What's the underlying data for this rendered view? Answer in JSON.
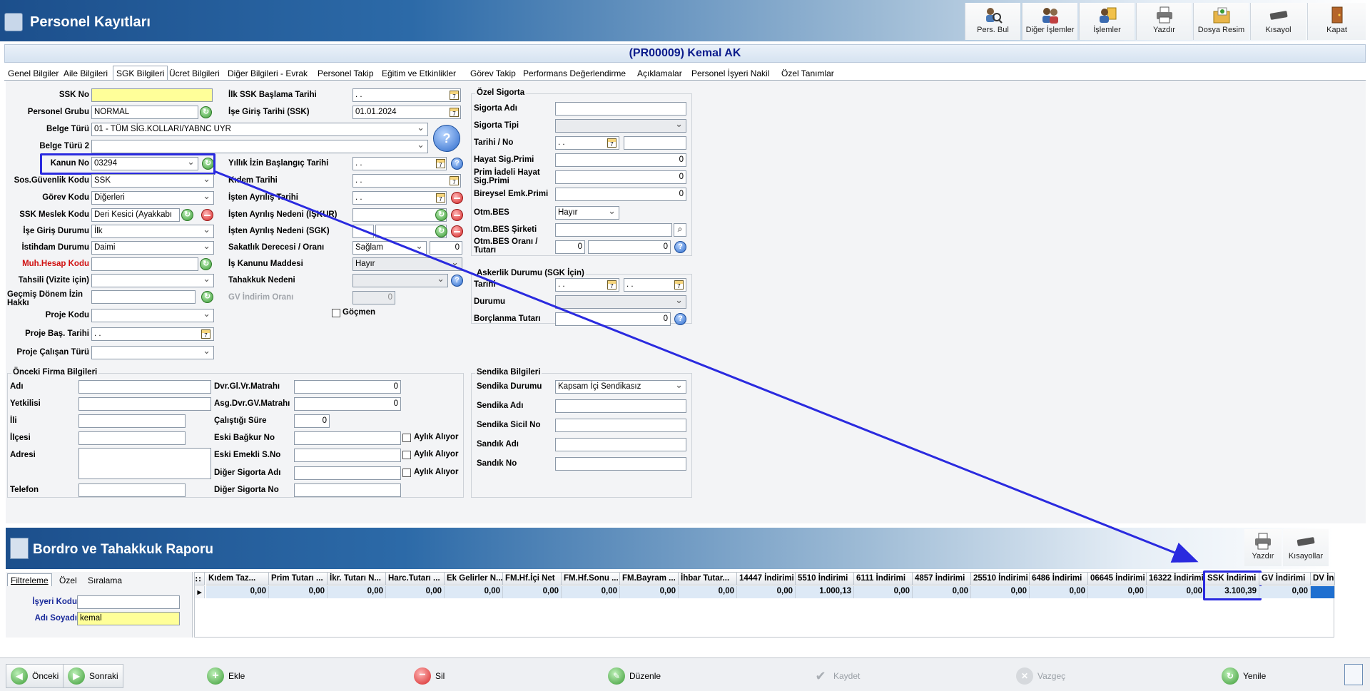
{
  "window": {
    "title": "Personel Kayıtları"
  },
  "toolbar": [
    {
      "label": "Pers. Bul",
      "icon": "search-person-icon"
    },
    {
      "label": "Diğer İşlemler",
      "icon": "people-icon"
    },
    {
      "label": "İşlemler",
      "icon": "person-list-icon"
    },
    {
      "label": "Yazdır",
      "icon": "printer-icon"
    },
    {
      "label": "Dosya Resim",
      "icon": "folder-image-icon"
    },
    {
      "label": "Kısayol",
      "icon": "keyboard-icon"
    },
    {
      "label": "Kapat",
      "icon": "exit-door-icon"
    }
  ],
  "record": {
    "heading": "(PR00009) Kemal AK"
  },
  "tabs": [
    "Genel Bilgiler",
    "Aile Bilgileri",
    "SGK Bilgileri",
    "Ücret Bilgileri",
    "Diğer Bilgileri - Evrak",
    "Personel Takip",
    "Eğitim ve Etkinlikler",
    "Görev Takip",
    "Performans Değerlendirme",
    "Açıklamalar",
    "Personel İşyeri Nakil",
    "Özel Tanımlar"
  ],
  "left_form": {
    "ssk_no": {
      "label": "SSK No",
      "value": ""
    },
    "personel_grubu": {
      "label": "Personel Grubu",
      "value": "NORMAL"
    },
    "belge_turu": {
      "label": "Belge Türü",
      "value": "01 - TÜM SİG.KOLLARI/YABNC UYR"
    },
    "belge_turu_2": {
      "label": "Belge Türü 2",
      "value": ""
    },
    "kanun_no": {
      "label": "Kanun No",
      "value": "03294"
    },
    "sos_guvenlik": {
      "label": "Sos.Güvenlik Kodu",
      "value": "SSK"
    },
    "gorev_kodu": {
      "label": "Görev Kodu",
      "value": "Diğerleri"
    },
    "ssk_meslek": {
      "label": "SSK Meslek Kodu",
      "value": "Deri Kesici (Ayakkabı"
    },
    "ise_giris_durumu": {
      "label": "İşe Giriş Durumu",
      "value": "İlk"
    },
    "istihdam": {
      "label": "İstihdam Durumu",
      "value": "Daimi"
    },
    "muh_hesap": {
      "label": "Muh.Hesap Kodu",
      "value": ""
    },
    "tahsili": {
      "label": "Tahsili (Vizite için)",
      "value": ""
    },
    "gecmis_donem": {
      "label": "Geçmiş Dönem İzin Hakkı",
      "value": ""
    },
    "proje_kodu": {
      "label": "Proje Kodu",
      "value": ""
    },
    "proje_bas": {
      "label": "Proje Baş. Tarihi",
      "value": ". ."
    },
    "proje_calisan": {
      "label": "Proje Çalışan Türü",
      "value": ""
    }
  },
  "mid_form": {
    "ilk_ssk": {
      "label": "İlk SSK Başlama Tarihi",
      "value": ". ."
    },
    "ise_giris": {
      "label": "İşe Giriş Tarihi (SSK)",
      "value": "01.01.2024"
    },
    "yillik_izin": {
      "label": "Yıllık İzin Başlangıç Tarihi",
      "value": ". ."
    },
    "kidem": {
      "label": "Kıdem Tarihi",
      "value": ". ."
    },
    "isten_ayrilis": {
      "label": "İşten Ayrılış Tarihi",
      "value": ". ."
    },
    "ayrilis_iskur": {
      "label": "İşten Ayrılış Nedeni (İŞKUR)",
      "value": ""
    },
    "ayrilis_sgk": {
      "label": "İşten Ayrılış Nedeni (SGK)",
      "value": ""
    },
    "sakatlik": {
      "label": "Sakatlık Derecesi / Oranı",
      "value": "Sağlam",
      "oran": "0"
    },
    "is_kanunu": {
      "label": "İş Kanunu Maddesi",
      "value": "Hayır"
    },
    "tahakkuk": {
      "label": "Tahakkuk Nedeni",
      "value": ""
    },
    "gv_indirim": {
      "label": "GV İndirim Oranı",
      "value": "0"
    },
    "gocmen": {
      "label": "Göçmen"
    }
  },
  "ozel_sigorta": {
    "title": "Özel Sigorta",
    "sigorta_adi": {
      "label": "Sigorta Adı",
      "value": ""
    },
    "sigorta_tipi": {
      "label": "Sigorta Tipi",
      "value": ""
    },
    "tarihi_no": {
      "label": "Tarihi / No",
      "value": ". .",
      "no": ""
    },
    "hayat": {
      "label": "Hayat Sig.Primi",
      "value": "0"
    },
    "prim_iadeli": {
      "label": "Prim İadeli Hayat Sig.Primi",
      "value": "0"
    },
    "bireysel": {
      "label": "Bireysel Emk.Primi",
      "value": "0"
    },
    "otm_bes": {
      "label": "Otm.BES",
      "value": "Hayır"
    },
    "otm_bes_sirketi": {
      "label": "Otm.BES Şirketi",
      "value": ""
    },
    "otm_bes_oran": {
      "label": "Otm.BES Oranı / Tutarı",
      "oran": "0",
      "tutar": "0"
    }
  },
  "askerlik": {
    "title": "Askerlik Durumu (SGK İçin)",
    "tarihi": {
      "label": "Tarihi",
      "v1": ". .",
      "v2": ". ."
    },
    "durumu": {
      "label": "Durumu",
      "value": ""
    },
    "borclanma": {
      "label": "Borçlanma Tutarı",
      "value": "0"
    }
  },
  "onceki_firma": {
    "title": "Önceki Firma Bilgileri",
    "adi": "Adı",
    "yetkilisi": "Yetkilisi",
    "ili": "İli",
    "ilcesi": "İlçesi",
    "adresi": "Adresi",
    "telefon": "Telefon",
    "dvr_gl": {
      "label": "Dvr.Gl.Vr.Matrahı",
      "value": "0"
    },
    "asg_dvr": {
      "label": "Asg.Dvr.GV.Matrahı",
      "value": "0"
    },
    "calistigi": {
      "label": "Çalıştığı Süre",
      "value": "0"
    },
    "eski_bagkur": "Eski Bağkur No",
    "eski_emekli": "Eski Emekli S.No",
    "diger_sigorta_adi": "Diğer Sigorta Adı",
    "diger_sigorta_no": "Diğer Sigorta No",
    "aylik_aliyor": "Aylık Alıyor"
  },
  "sendika": {
    "title": "Sendika Bilgileri",
    "durumu": {
      "label": "Sendika Durumu",
      "value": "Kapsam İçi Sendikasız"
    },
    "adi": "Sendika Adı",
    "sicil": "Sendika Sicil No",
    "sandik_adi": "Sandık Adı",
    "sandik_no": "Sandık No"
  },
  "report": {
    "title": "Bordro ve Tahakkuk Raporu",
    "toolbar": [
      {
        "label": "Yazdır",
        "icon": "printer-icon"
      },
      {
        "label": "Kısayollar",
        "icon": "keyboard-icon"
      }
    ],
    "filter_tabs": [
      "Filtreleme",
      "Özel",
      "Sıralama"
    ],
    "isyeri_kodu": {
      "label": "İşyeri Kodu",
      "value": ""
    },
    "adi_soyadi": {
      "label": "Adı Soyadı",
      "value": "kemal"
    },
    "columns": [
      "Kıdem Taz...",
      "Prim Tutarı ...",
      "İkr. Tutarı N...",
      "Harc.Tutarı ...",
      "Ek Gelirler N...",
      "FM.Hf.İçi Net",
      "FM.Hf.Sonu ...",
      "FM.Bayram ...",
      "İhbar Tutar...",
      "14447 İndirimi",
      "5510 İndirimi",
      "6111 İndirimi",
      "4857 İndirimi",
      "25510 İndirimi",
      "6486 İndirimi",
      "06645 İndirimi",
      "16322 İndirimi",
      "SSK İndirimi",
      "GV İndirimi",
      "DV İnd"
    ],
    "row": [
      "0,00",
      "0,00",
      "0,00",
      "0,00",
      "0,00",
      "0,00",
      "0,00",
      "0,00",
      "0,00",
      "0,00",
      "1.000,13",
      "0,00",
      "0,00",
      "0,00",
      "0,00",
      "0,00",
      "0,00",
      "3.100,39",
      "0,00",
      ""
    ]
  },
  "footer": {
    "onceki": "Önceki",
    "sonraki": "Sonraki",
    "ekle": "Ekle",
    "sil": "Sil",
    "duzenle": "Düzenle",
    "kaydet": "Kaydet",
    "vazgec": "Vazgeç",
    "yenile": "Yenile"
  },
  "colors": {
    "accent": "#1c4f8c",
    "highlight": "#2a2adf",
    "required": "#ffff99"
  }
}
